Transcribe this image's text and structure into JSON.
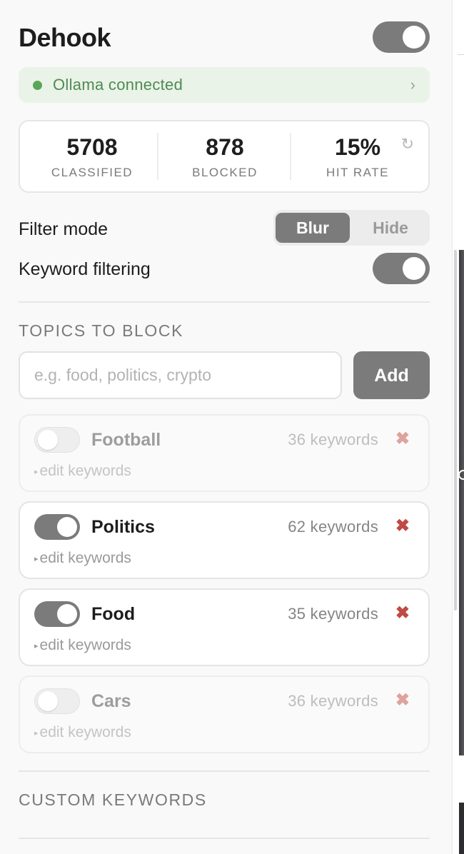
{
  "app": {
    "title": "Dehook",
    "enabled": true
  },
  "status": {
    "text": "Ollama connected",
    "chevron": "›",
    "color": "#5aa659"
  },
  "stats": {
    "items": [
      {
        "value": "5708",
        "label": "CLASSIFIED"
      },
      {
        "value": "878",
        "label": "BLOCKED"
      },
      {
        "value": "15%",
        "label": "HIT RATE"
      }
    ],
    "refresh_icon": "refresh-icon",
    "refresh_glyph": "↻"
  },
  "filter_mode": {
    "label": "Filter mode",
    "options": [
      "Blur",
      "Hide"
    ],
    "selected": "Blur"
  },
  "keyword_filtering": {
    "label": "Keyword filtering",
    "enabled": true
  },
  "topics": {
    "section_title": "TOPICS TO BLOCK",
    "input_placeholder": "e.g. food, politics, crypto",
    "input_value": "",
    "add_label": "Add",
    "edit_label": "edit keywords",
    "edit_glyph": "▸",
    "delete_glyph": "✖",
    "items": [
      {
        "name": "Football",
        "keywords": "36 keywords",
        "enabled": false
      },
      {
        "name": "Politics",
        "keywords": "62 keywords",
        "enabled": true
      },
      {
        "name": "Food",
        "keywords": "35 keywords",
        "enabled": true
      },
      {
        "name": "Cars",
        "keywords": "36 keywords",
        "enabled": false
      }
    ]
  },
  "custom_keywords": {
    "section_title": "CUSTOM KEYWORDS"
  },
  "colors": {
    "accent_gray": "#7b7b7b",
    "delete_red": "#c04a43",
    "status_bg": "#eaf3e8"
  }
}
